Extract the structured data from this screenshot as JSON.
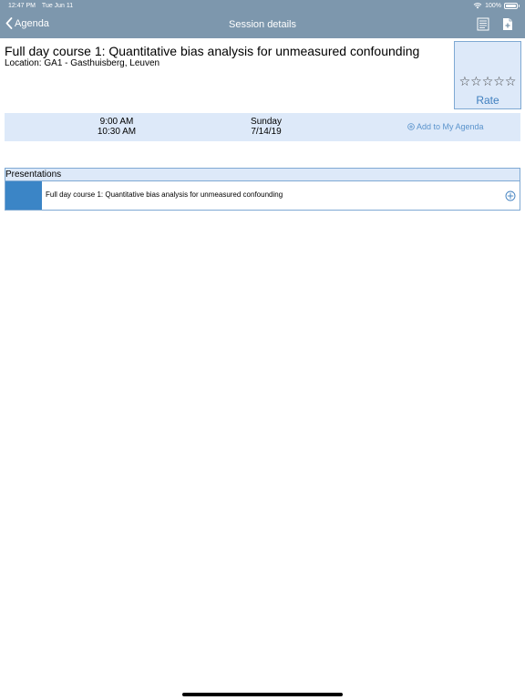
{
  "status_bar": {
    "time": "12:47 PM",
    "date": "Tue Jun 11",
    "battery": "100%"
  },
  "nav": {
    "back_label": "Agenda",
    "title": "Session details"
  },
  "session": {
    "title": "Full day course 1: Quantitative bias analysis for unmeasured confounding",
    "location": "Location: GA1 - Gasthuisberg, Leuven"
  },
  "rating": {
    "stars": [
      "☆",
      "☆",
      "☆",
      "☆",
      "☆"
    ],
    "label": "Rate"
  },
  "schedule": {
    "start_time": "9:00 AM",
    "end_time": "10:30 AM",
    "weekday": "Sunday",
    "date": "7/14/19",
    "add_label": "Add to My Agenda"
  },
  "presentations": {
    "header": "Presentations",
    "items": [
      {
        "title": "Full day course 1: Quantitative bias analysis for unmeasured confounding",
        "color": "#3b85c6"
      }
    ]
  },
  "colors": {
    "header": "#7d97ad",
    "accent": "#3f7fbf",
    "panel": "#dde9f9",
    "border": "#7fa9d3"
  }
}
